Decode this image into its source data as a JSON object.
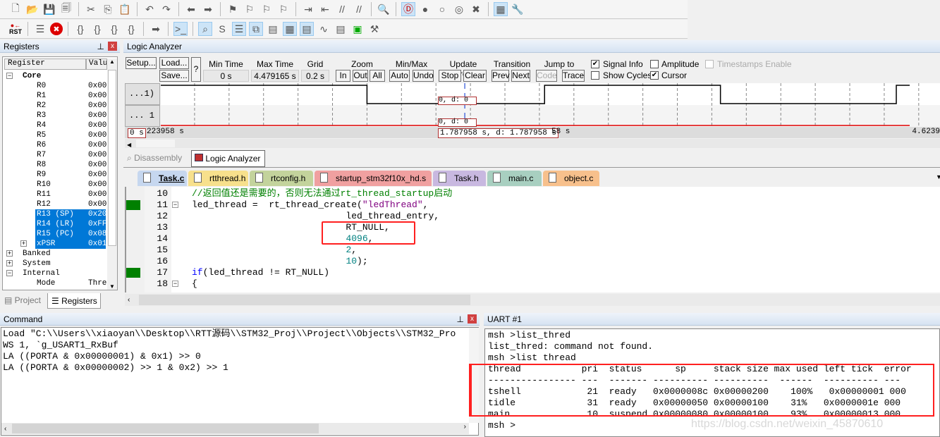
{
  "toolbar": {
    "row1": [
      "new-file",
      "open-file",
      "save",
      "save-all",
      "cut",
      "copy",
      "paste",
      "undo",
      "redo",
      "back",
      "forward",
      "bookmark",
      "prev-bookmark",
      "next-bookmark",
      "clear-bookmarks",
      "indent",
      "unindent",
      "comment",
      "uncomment",
      "find-in-files",
      "debug-session",
      "insert-breakpoint",
      "enable-breakpoint",
      "disable-breakpoint",
      "kill-breakpoints",
      "window-layout",
      "configure"
    ],
    "row2": {
      "rst": "RST",
      "icons": [
        "reset",
        "run",
        "stop",
        "step",
        "step-over",
        "step-out",
        "run-to-cursor",
        "show-next",
        "command-window",
        "disassembly-window",
        "symbols-window",
        "registers-window",
        "call-stack-window",
        "watch-window",
        "memory-window",
        "serial-window",
        "analysis-window",
        "trace-window",
        "system-viewer",
        "toolbox"
      ]
    }
  },
  "registers": {
    "title": "Registers",
    "col_register": "Register",
    "col_value": "Valu",
    "items": [
      {
        "name": "Core",
        "value": "",
        "bold": true,
        "sign": "−"
      },
      {
        "name": "R0",
        "value": "0x00"
      },
      {
        "name": "R1",
        "value": "0x00"
      },
      {
        "name": "R2",
        "value": "0x00"
      },
      {
        "name": "R3",
        "value": "0x00"
      },
      {
        "name": "R4",
        "value": "0x00"
      },
      {
        "name": "R5",
        "value": "0x00"
      },
      {
        "name": "R6",
        "value": "0x00"
      },
      {
        "name": "R7",
        "value": "0x00"
      },
      {
        "name": "R8",
        "value": "0x00"
      },
      {
        "name": "R9",
        "value": "0x00"
      },
      {
        "name": "R10",
        "value": "0x00"
      },
      {
        "name": "R11",
        "value": "0x00"
      },
      {
        "name": "R12",
        "value": "0x00"
      },
      {
        "name": "R13 (SP)",
        "value": "0x20",
        "selected": true
      },
      {
        "name": "R14 (LR)",
        "value": "0xFF",
        "selected": true
      },
      {
        "name": "R15 (PC)",
        "value": "0x08",
        "selected": true
      },
      {
        "name": "xPSR",
        "value": "0x01",
        "selected": true,
        "sign": "+"
      },
      {
        "name": "Banked",
        "value": "",
        "sign": "+"
      },
      {
        "name": "System",
        "value": "",
        "sign": "+"
      },
      {
        "name": "Internal",
        "value": "",
        "sign": "−"
      },
      {
        "name": "Mode",
        "value": "Thre"
      }
    ],
    "tabs": [
      "Project",
      "Registers"
    ],
    "active_tab": "Registers"
  },
  "logic_analyzer": {
    "title": "Logic Analyzer",
    "setup": "Setup...",
    "load": "Load...",
    "save": "Save...",
    "help": "?",
    "min_time_label": "Min Time",
    "min_time": "0 s",
    "max_time_label": "Max Time",
    "max_time": "4.479165 s",
    "grid_label": "Grid",
    "grid": "0.2 s",
    "zoom_label": "Zoom",
    "zoom_in": "In",
    "zoom_out": "Out",
    "zoom_all": "All",
    "minmax_label": "Min/Max",
    "auto": "Auto",
    "undo": "Undo",
    "update_label": "Update Screen",
    "stop": "Stop",
    "clear": "Clear",
    "transition_label": "Transition",
    "prev": "Prev",
    "next": "Next",
    "jump_label": "Jump to",
    "code": "Code",
    "trace": "Trace",
    "signal_info": {
      "label": "Signal Info",
      "checked": true
    },
    "amplitude": {
      "label": "Amplitude",
      "checked": false
    },
    "timestamps": {
      "label": "Timestamps Enable",
      "checked": false,
      "disabled": true
    },
    "show_cycles": {
      "label": "Show Cycles",
      "checked": false
    },
    "cursor": {
      "label": "Cursor",
      "checked": true
    },
    "signals": [
      {
        "label": "...1)",
        "cursor_value": "0,   d: 0",
        "color": "#000000",
        "initial": 1,
        "transitions_s": [
          1.0,
          2.03,
          3.05,
          4.07
        ]
      },
      {
        "label": "... 1",
        "cursor_value": "0,   d: 0",
        "color": "#e00000",
        "initial": 0,
        "transitions_s": []
      }
    ],
    "time_start": "0 s",
    "time_partial": "223958 s",
    "cursor_time": "1.787958  s,  d: 1.787958  s",
    "cursor_time_tail": "58 s",
    "time_end": "4.6239",
    "cursor_s": 1.787958
  },
  "view_tabs": [
    {
      "label": "Disassembly",
      "active": false
    },
    {
      "label": "Logic Analyzer",
      "active": true
    }
  ],
  "file_tabs": [
    {
      "label": "Task.c",
      "color": "#c6d7ef",
      "active": true
    },
    {
      "label": "rtthread.h",
      "color": "#f7e08c"
    },
    {
      "label": "rtconfig.h",
      "color": "#c3d39c"
    },
    {
      "label": "startup_stm32f10x_hd.s",
      "color": "#f0a0a0"
    },
    {
      "label": "Task.h",
      "color": "#c8b8e0"
    },
    {
      "label": "main.c",
      "color": "#a8cfc0"
    },
    {
      "label": "object.c",
      "color": "#f7c08c"
    }
  ],
  "code": [
    {
      "n": "10",
      "text": "//返回值还是需要的，否则无法通过rt_thread_startup启动",
      "kind": "comment"
    },
    {
      "n": "11",
      "text": "led_thread =  rt_thread_create(",
      "str": "\"ledThread\"",
      "tail": ",",
      "bp": true,
      "fold": "−"
    },
    {
      "n": "12",
      "text": "                            led_thread_entry,"
    },
    {
      "n": "13",
      "text": "                            RT_NULL,"
    },
    {
      "n": "14",
      "text": "                            ",
      "num": "4096",
      "tail": ","
    },
    {
      "n": "15",
      "text": "                            ",
      "num": "2",
      "tail": ","
    },
    {
      "n": "16",
      "text": "                            ",
      "num": "10",
      "tail": ");"
    },
    {
      "n": "17",
      "text": "",
      "kw": "if",
      "tail": "(led_thread != RT_NULL)",
      "bp": true
    },
    {
      "n": "18",
      "text": "{",
      "fold": "−"
    }
  ],
  "command": {
    "title": "Command",
    "lines": [
      "Load \"C:\\\\Users\\\\xiaoyan\\\\Desktop\\\\RTT源码\\\\STM32_Proj\\\\Project\\\\Objects\\\\STM32_Pro",
      "WS 1, `g_USART1_RxBuf",
      "LA ((PORTA & 0x00000001) & 0x1) >> 0",
      "LA ((PORTA & 0x00000002) >> 1 & 0x2) >> 1"
    ]
  },
  "uart": {
    "title": "UART #1",
    "lines": [
      "msh >list_thred",
      "list_thred: command not found.",
      "msh >list thread",
      "thread           pri  status      sp     stack size max used left tick  error",
      "---------------- ---  ------- ---------- ----------  ------  ---------- ---",
      "tshell            21  ready   0x0000008c 0x00000200    100%   0x00000001 000",
      "tidle             31  ready   0x00000050 0x00000100    31%   0x0000001e 000",
      "main              10  suspend 0x00000080 0x00000100    93%   0x00000013 000",
      "msh >"
    ],
    "watermark": "https://blog.csdn.net/weixin_45870610"
  },
  "colors": {
    "selection": "#0078d7",
    "highlight_box": "#ff0000",
    "breakpoint": "#008000",
    "comment": "#008000",
    "number": "#008080",
    "string": "#800080",
    "keyword": "#0000ff"
  }
}
